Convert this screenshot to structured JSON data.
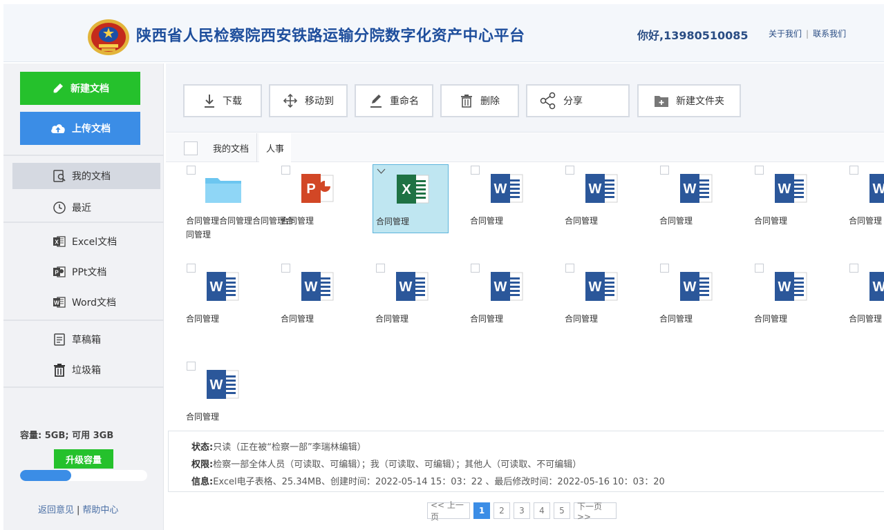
{
  "header": {
    "title": "陕西省人民检察院西安铁路运输分院数字化资产中心平台",
    "greeting": "你好,13980510085",
    "links": [
      "关于我们",
      "联系我们"
    ]
  },
  "sidebar": {
    "new_doc": "新建文档",
    "upload_doc": "上传文档",
    "nav": [
      {
        "label": "我的文档",
        "icon": "my-docs-icon",
        "active": true
      },
      {
        "label": "最近",
        "icon": "clock-icon"
      },
      {
        "label": "Excel文档",
        "icon": "excel-icon"
      },
      {
        "label": "PPt文档",
        "icon": "ppt-icon"
      },
      {
        "label": "Word文档",
        "icon": "word-icon"
      },
      {
        "label": "草稿箱",
        "icon": "draft-icon"
      },
      {
        "label": "垃圾箱",
        "icon": "trash-icon"
      }
    ],
    "capacity": "容量:  5GB;  可用 3GB",
    "upgrade": "升级容量",
    "usage_fraction": 0.4,
    "feedback": "返回意见",
    "help": "帮助中心"
  },
  "toolbar": {
    "download": "下载",
    "move": "移动到",
    "rename": "重命名",
    "delete": "删除",
    "share": "分享",
    "new_folder": "新建文件夹"
  },
  "breadcrumb": [
    "我的文档",
    "人事"
  ],
  "files": [
    {
      "name": "合同管理合同管理合同管理合同管理",
      "type": "folder"
    },
    {
      "name": "合同管理",
      "type": "ppt"
    },
    {
      "name": "合同管理",
      "type": "excel",
      "selected": true
    },
    {
      "name": "合同管理",
      "type": "word"
    },
    {
      "name": "合同管理",
      "type": "word"
    },
    {
      "name": "合同管理",
      "type": "word"
    },
    {
      "name": "合同管理",
      "type": "word"
    },
    {
      "name": "合同管理",
      "type": "word"
    },
    {
      "name": "合同管理",
      "type": "word"
    },
    {
      "name": "合同管理",
      "type": "word"
    },
    {
      "name": "合同管理",
      "type": "word"
    },
    {
      "name": "合同管理",
      "type": "word"
    },
    {
      "name": "合同管理",
      "type": "word"
    },
    {
      "name": "合同管理",
      "type": "word"
    },
    {
      "name": "合同管理",
      "type": "word"
    },
    {
      "name": "合同管理",
      "type": "word"
    },
    {
      "name": "合同管理",
      "type": "word"
    }
  ],
  "info": {
    "status_label": "状态:",
    "status": "只读（正在被“检察一部”李瑞林编辑）",
    "perm_label": "权限:",
    "perm": "检察一部全体人员（可读取、可编辑）；我（可读取、可编辑）；其他人（可读取、不可编辑）",
    "info_label": "信息:",
    "info": "Excel电子表格、25.34MB、创建时间：2022-05-14 15：03：22 、最后修改时间：2022-05-16 10：03：20"
  },
  "pager": {
    "prev": "<< 上一页",
    "pages": [
      "1",
      "2",
      "3",
      "4",
      "5"
    ],
    "current": "1",
    "next": "下一页 >>"
  },
  "colors": {
    "brand": "#1e4e9c",
    "green": "#25c12c",
    "blue": "#3b8de6",
    "excel": "#1f7244",
    "ppt": "#d24726",
    "word": "#2b579a",
    "folder": "#6cc6f0"
  }
}
